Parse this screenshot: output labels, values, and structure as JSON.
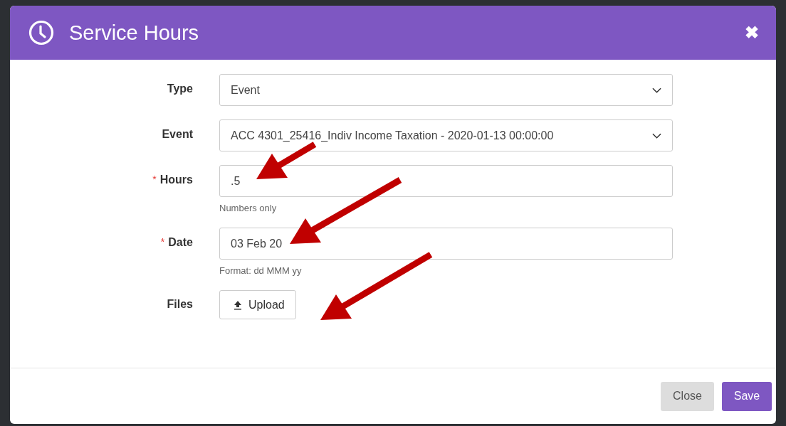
{
  "dialog": {
    "title": "Service Hours",
    "close_symbol": "✖"
  },
  "fields": [
    {
      "kind": "select",
      "label": "Type",
      "required": false,
      "value": "Event"
    },
    {
      "kind": "select",
      "label": "Event",
      "required": false,
      "value": "ACC 4301_25416_Indiv Income Taxation - 2020-01-13 00:00:00"
    },
    {
      "kind": "text",
      "label": "Hours",
      "required": true,
      "required_mark": "*",
      "value": ".5",
      "help": "Numbers only"
    },
    {
      "kind": "text",
      "label": "Date",
      "required": true,
      "required_mark": "*",
      "value": "03 Feb 20",
      "help": "Format: dd MMM yy"
    },
    {
      "kind": "upload",
      "label": "Files",
      "required": false,
      "button": "Upload"
    }
  ],
  "footer": {
    "buttons": [
      {
        "label": "Close",
        "kind": "secondary"
      },
      {
        "label": "Save",
        "kind": "primary"
      }
    ]
  }
}
